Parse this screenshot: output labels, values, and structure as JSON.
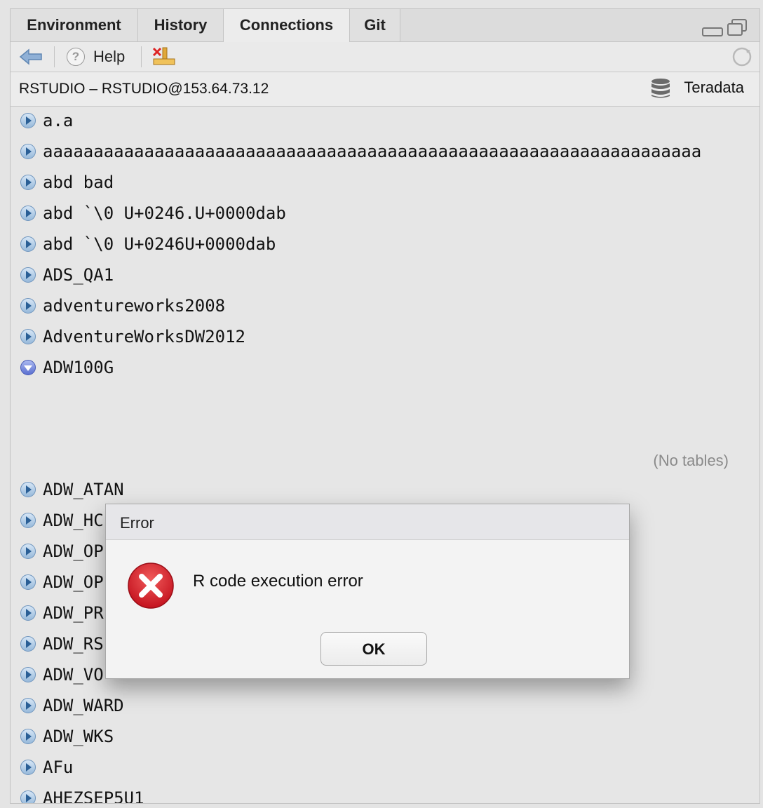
{
  "tabs": [
    "Environment",
    "History",
    "Connections",
    "Git"
  ],
  "active_tab": "Connections",
  "toolbar": {
    "help_label": "Help"
  },
  "connection": {
    "title": "RSTUDIO – RSTUDIO@153.64.73.12",
    "type": "Teradata"
  },
  "schemas": [
    {
      "label": "a.a",
      "expanded": false
    },
    {
      "label": "aaaaaaaaaaaaaaaaaaaaaaaaaaaaaaaaaaaaaaaaaaaaaaaaaaaaaaaaaaaaaaaaa",
      "expanded": false
    },
    {
      "label": "abd bad",
      "expanded": false
    },
    {
      "label": "abd `\\0 U+0246.U+0000dab",
      "expanded": false
    },
    {
      "label": "abd `\\0 U+0246U+0000dab",
      "expanded": false
    },
    {
      "label": "ADS_QA1",
      "expanded": false
    },
    {
      "label": "adventureworks2008",
      "expanded": false
    },
    {
      "label": "AdventureWorksDW2012",
      "expanded": false
    },
    {
      "label": "ADW100G",
      "expanded": true
    },
    {
      "label": "ADW_ATAN",
      "expanded": false
    },
    {
      "label": "ADW_HC",
      "expanded": false
    },
    {
      "label": "ADW_OP",
      "expanded": false
    },
    {
      "label": "ADW_OP",
      "expanded": false
    },
    {
      "label": "ADW_PR",
      "expanded": false
    },
    {
      "label": "ADW_RS",
      "expanded": false
    },
    {
      "label": "ADW_VO",
      "expanded": false
    },
    {
      "label": "ADW_WARD",
      "expanded": false
    },
    {
      "label": "ADW_WKS",
      "expanded": false
    },
    {
      "label": "AFu",
      "expanded": false
    },
    {
      "label": "AHEZSEP5U1",
      "expanded": false
    }
  ],
  "expanded_note": "(No tables)",
  "dialog": {
    "title": "Error",
    "message": "R code execution error",
    "ok_label": "OK"
  },
  "colors": {
    "panel_bg": "#e4e4e4",
    "error_red": "#d8202c",
    "expand_blue": "#5a6fd0"
  }
}
